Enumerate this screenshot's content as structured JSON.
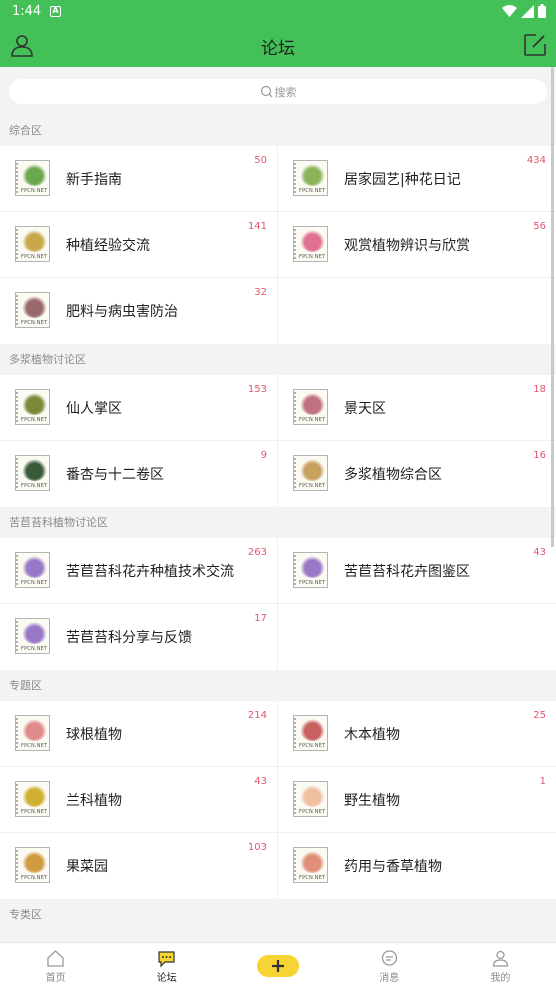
{
  "status": {
    "time": "1:44",
    "notif": "A"
  },
  "topbar": {
    "title": "论坛"
  },
  "search": {
    "placeholder": "搜索"
  },
  "sections": [
    {
      "title": "综合区",
      "items": [
        {
          "name": "新手指南",
          "count": "50",
          "color": "#6aa84f"
        },
        {
          "name": "居家园艺|种花日记",
          "count": "434",
          "color": "#8db35a"
        },
        {
          "name": "种植经验交流",
          "count": "141",
          "color": "#c8a84a"
        },
        {
          "name": "观赏植物辨识与欣赏",
          "count": "56",
          "color": "#e07090"
        },
        {
          "name": "肥料与病虫害防治",
          "count": "32",
          "color": "#9a6a6a"
        }
      ]
    },
    {
      "title": "多浆植物讨论区",
      "items": [
        {
          "name": "仙人掌区",
          "count": "153",
          "color": "#7a8a3a"
        },
        {
          "name": "景天区",
          "count": "18",
          "color": "#c07080"
        },
        {
          "name": "番杏与十二卷区",
          "count": "9",
          "color": "#3a5a3a"
        },
        {
          "name": "多浆植物综合区",
          "count": "16",
          "color": "#c8a060"
        }
      ]
    },
    {
      "title": "苦苣苔科植物讨论区",
      "items": [
        {
          "name": "苦苣苔科花卉种植技术交流",
          "count": "263",
          "color": "#9a78c8"
        },
        {
          "name": "苦苣苔科花卉图鉴区",
          "count": "43",
          "color": "#9a78c8"
        },
        {
          "name": "苦苣苔科分享与反馈",
          "count": "17",
          "color": "#9a78c8"
        }
      ]
    },
    {
      "title": "专题区",
      "items": [
        {
          "name": "球根植物",
          "count": "214",
          "color": "#e08a8a"
        },
        {
          "name": "木本植物",
          "count": "25",
          "color": "#c86060"
        },
        {
          "name": "兰科植物",
          "count": "43",
          "color": "#d0b030"
        },
        {
          "name": "野生植物",
          "count": "1",
          "color": "#f0c0a0"
        },
        {
          "name": "果菜园",
          "count": "103",
          "color": "#d09a40"
        },
        {
          "name": "药用与香草植物",
          "count": "",
          "color": "#e0907a"
        }
      ]
    },
    {
      "title": "专类区",
      "items": []
    }
  ],
  "thumb_brand": "FPCN.NET",
  "nav": [
    {
      "label": "首页",
      "icon": "home-icon"
    },
    {
      "label": "论坛",
      "icon": "forum-icon"
    },
    {
      "label": "",
      "icon": "plus-icon"
    },
    {
      "label": "消息",
      "icon": "message-icon"
    },
    {
      "label": "我的",
      "icon": "profile-icon"
    }
  ]
}
